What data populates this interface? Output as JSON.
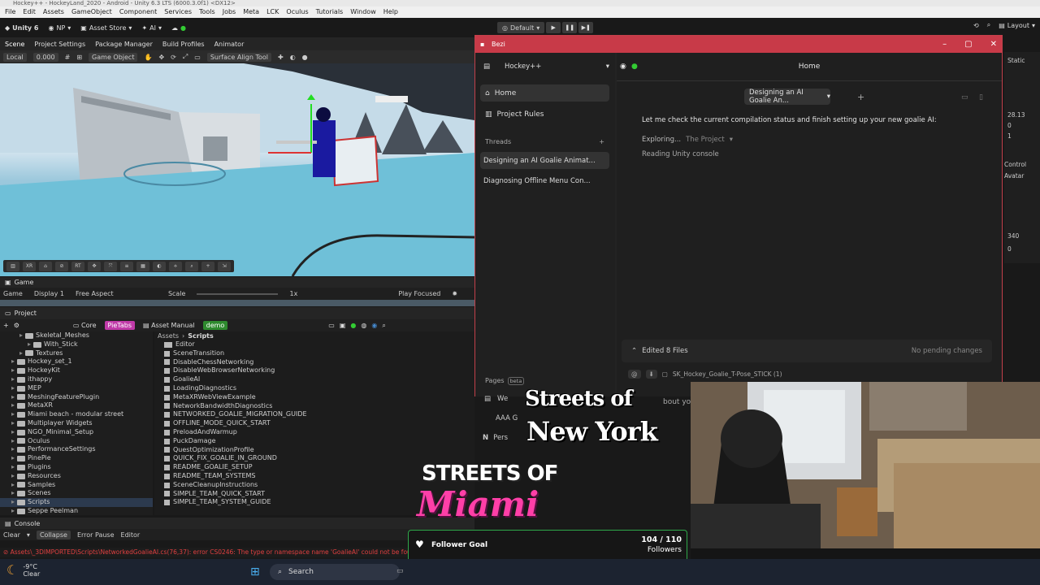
{
  "window": {
    "title": "Hockey++ - HockeyLand_2020 - Android - Unity 6.3 LTS (6000.3.0f1) <DX12>"
  },
  "menu": [
    "File",
    "Edit",
    "Assets",
    "GameObject",
    "Component",
    "Services",
    "Tools",
    "Jobs",
    "Meta",
    "LCK",
    "Oculus",
    "Tutorials",
    "Window",
    "Help"
  ],
  "toolbar": {
    "brand": "Unity 6",
    "account": "NP",
    "asset_store": "Asset Store",
    "ai": "AI",
    "play_mode": "Default",
    "layout": "Layout"
  },
  "scene_tabs": [
    "Scene",
    "Project Settings",
    "Package Manager",
    "Build Profiles",
    "Animator"
  ],
  "scene_toolbar": {
    "pivot": "Local",
    "value": "0.000",
    "object_mode": "Game Object",
    "surface_tool": "Surface Align Tool"
  },
  "game": {
    "tab": "Game",
    "mode": "Game",
    "display": "Display 1",
    "aspect": "Free Aspect",
    "scale_label": "Scale",
    "scale_value": "1x",
    "play_focus": "Play Focused"
  },
  "project": {
    "tab": "Project",
    "tags": [
      {
        "label": "Core",
        "color": "transparent"
      },
      {
        "label": "PieTabs",
        "color": "#c03aa8"
      },
      {
        "label": "Asset Manual",
        "color": "transparent"
      },
      {
        "label": "demo",
        "color": "#2e8a2e"
      }
    ],
    "tree": [
      {
        "label": "Skeletal_Meshes",
        "indent": 1
      },
      {
        "label": "With_Stick",
        "indent": 2
      },
      {
        "label": "Textures",
        "indent": 1
      },
      {
        "label": "Hockey_set_1",
        "indent": 0
      },
      {
        "label": "HockeyKit",
        "indent": 0
      },
      {
        "label": "ithappy",
        "indent": 0
      },
      {
        "label": "MEP",
        "indent": 0
      },
      {
        "label": "MeshingFeaturePlugin",
        "indent": 0
      },
      {
        "label": "MetaXR",
        "indent": 0
      },
      {
        "label": "Miami beach - modular street",
        "indent": 0
      },
      {
        "label": "Multiplayer Widgets",
        "indent": 0
      },
      {
        "label": "NGO_Minimal_Setup",
        "indent": 0
      },
      {
        "label": "Oculus",
        "indent": 0
      },
      {
        "label": "PerformanceSettings",
        "indent": 0
      },
      {
        "label": "PinePie",
        "indent": 0
      },
      {
        "label": "Plugins",
        "indent": 0
      },
      {
        "label": "Resources",
        "indent": 0
      },
      {
        "label": "Samples",
        "indent": 0
      },
      {
        "label": "Scenes",
        "indent": 0
      },
      {
        "label": "Scripts",
        "indent": 0
      },
      {
        "label": "Seppe Peelman",
        "indent": 0
      }
    ],
    "breadcrumb": [
      "Assets",
      "Scripts"
    ],
    "files": [
      "Editor",
      "SceneTransition",
      "DisableChessNetworking",
      "DisableWebBrowserNetworking",
      "GoalieAI",
      "LoadingDiagnostics",
      "MetaXRWebViewExample",
      "NetworkBandwidthDiagnostics",
      "NETWORKED_GOALIE_MIGRATION_GUIDE",
      "OFFLINE_MODE_QUICK_START",
      "PreloadAndWarmup",
      "PuckDamage",
      "QuestOptimizationProfile",
      "QUICK_FIX_GOALIE_IN_GROUND",
      "README_GOALIE_SETUP",
      "README_TEAM_SYSTEMS",
      "SceneCleanupInstructions",
      "SIMPLE_TEAM_QUICK_START",
      "SIMPLE_TEAM_SYSTEM_GUIDE"
    ]
  },
  "console": {
    "tab": "Console",
    "buttons": [
      "Clear",
      "Collapse",
      "Error Pause",
      "Editor"
    ],
    "error": "Assets\\_3DIMPORTED\\Scripts\\NetworkedGoalieAI.cs(76,37): error CS0246: The type or namespace name 'GoalieAI' could not be fou"
  },
  "bezi": {
    "title": "Bezi",
    "project": "Hockey++",
    "nav": [
      "Home",
      "Project Rules"
    ],
    "threads_label": "Threads",
    "threads": [
      "Designing an AI Goalie Animat...",
      "Diagnosing Offline Menu Con..."
    ],
    "pages_label": "Pages",
    "pages_badge": "beta",
    "pages": [
      "We",
      "AAA G",
      "Pers"
    ],
    "header": "Home",
    "thread_pill": "Designing an AI Goalie An...",
    "message": "Let me check the current compilation status and finish setting up your new goalie AI:",
    "exploring_label": "Exploring...",
    "exploring_target": "The Project",
    "reading": "Reading Unity console",
    "edited_label": "Edited 8 Files",
    "pending": "No pending changes",
    "file_chip": "SK_Hockey_Goalie_T-Pose_STICK (1)",
    "partial_text": "bout yo"
  },
  "inspector_fragments": [
    "Static",
    "28.13",
    "0",
    "1",
    "Control",
    "Avatar",
    "340",
    "0"
  ],
  "overlay": {
    "ny_line1": "Streets of",
    "ny_line2": "New York",
    "miami_line1": "STREETS OF",
    "miami_line2": "Miami",
    "follower_label": "Follower Goal",
    "follower_count": "104 / 110",
    "follower_unit": "Followers",
    "follower_progress": 0.945
  },
  "taskbar": {
    "temp": "-9°C",
    "weather": "Clear",
    "search": "Search"
  },
  "colors": {
    "bezi_red": "#c83a48",
    "accent_green": "#22c23e",
    "error_red": "#e04040"
  }
}
